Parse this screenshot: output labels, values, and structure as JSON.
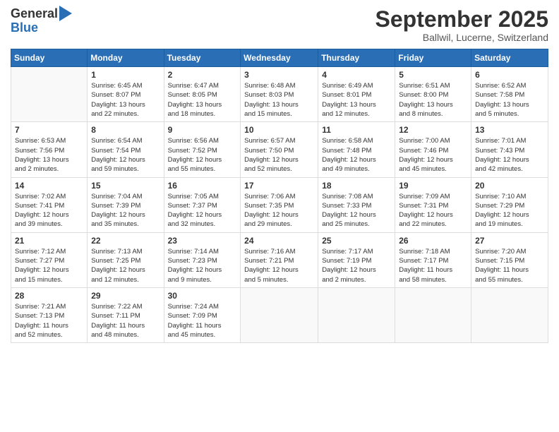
{
  "header": {
    "logo_general": "General",
    "logo_blue": "Blue",
    "month_title": "September 2025",
    "location": "Ballwil, Lucerne, Switzerland"
  },
  "days_of_week": [
    "Sunday",
    "Monday",
    "Tuesday",
    "Wednesday",
    "Thursday",
    "Friday",
    "Saturday"
  ],
  "weeks": [
    [
      {
        "day": "",
        "info": ""
      },
      {
        "day": "1",
        "info": "Sunrise: 6:45 AM\nSunset: 8:07 PM\nDaylight: 13 hours\nand 22 minutes."
      },
      {
        "day": "2",
        "info": "Sunrise: 6:47 AM\nSunset: 8:05 PM\nDaylight: 13 hours\nand 18 minutes."
      },
      {
        "day": "3",
        "info": "Sunrise: 6:48 AM\nSunset: 8:03 PM\nDaylight: 13 hours\nand 15 minutes."
      },
      {
        "day": "4",
        "info": "Sunrise: 6:49 AM\nSunset: 8:01 PM\nDaylight: 13 hours\nand 12 minutes."
      },
      {
        "day": "5",
        "info": "Sunrise: 6:51 AM\nSunset: 8:00 PM\nDaylight: 13 hours\nand 8 minutes."
      },
      {
        "day": "6",
        "info": "Sunrise: 6:52 AM\nSunset: 7:58 PM\nDaylight: 13 hours\nand 5 minutes."
      }
    ],
    [
      {
        "day": "7",
        "info": "Sunrise: 6:53 AM\nSunset: 7:56 PM\nDaylight: 13 hours\nand 2 minutes."
      },
      {
        "day": "8",
        "info": "Sunrise: 6:54 AM\nSunset: 7:54 PM\nDaylight: 12 hours\nand 59 minutes."
      },
      {
        "day": "9",
        "info": "Sunrise: 6:56 AM\nSunset: 7:52 PM\nDaylight: 12 hours\nand 55 minutes."
      },
      {
        "day": "10",
        "info": "Sunrise: 6:57 AM\nSunset: 7:50 PM\nDaylight: 12 hours\nand 52 minutes."
      },
      {
        "day": "11",
        "info": "Sunrise: 6:58 AM\nSunset: 7:48 PM\nDaylight: 12 hours\nand 49 minutes."
      },
      {
        "day": "12",
        "info": "Sunrise: 7:00 AM\nSunset: 7:46 PM\nDaylight: 12 hours\nand 45 minutes."
      },
      {
        "day": "13",
        "info": "Sunrise: 7:01 AM\nSunset: 7:43 PM\nDaylight: 12 hours\nand 42 minutes."
      }
    ],
    [
      {
        "day": "14",
        "info": "Sunrise: 7:02 AM\nSunset: 7:41 PM\nDaylight: 12 hours\nand 39 minutes."
      },
      {
        "day": "15",
        "info": "Sunrise: 7:04 AM\nSunset: 7:39 PM\nDaylight: 12 hours\nand 35 minutes."
      },
      {
        "day": "16",
        "info": "Sunrise: 7:05 AM\nSunset: 7:37 PM\nDaylight: 12 hours\nand 32 minutes."
      },
      {
        "day": "17",
        "info": "Sunrise: 7:06 AM\nSunset: 7:35 PM\nDaylight: 12 hours\nand 29 minutes."
      },
      {
        "day": "18",
        "info": "Sunrise: 7:08 AM\nSunset: 7:33 PM\nDaylight: 12 hours\nand 25 minutes."
      },
      {
        "day": "19",
        "info": "Sunrise: 7:09 AM\nSunset: 7:31 PM\nDaylight: 12 hours\nand 22 minutes."
      },
      {
        "day": "20",
        "info": "Sunrise: 7:10 AM\nSunset: 7:29 PM\nDaylight: 12 hours\nand 19 minutes."
      }
    ],
    [
      {
        "day": "21",
        "info": "Sunrise: 7:12 AM\nSunset: 7:27 PM\nDaylight: 12 hours\nand 15 minutes."
      },
      {
        "day": "22",
        "info": "Sunrise: 7:13 AM\nSunset: 7:25 PM\nDaylight: 12 hours\nand 12 minutes."
      },
      {
        "day": "23",
        "info": "Sunrise: 7:14 AM\nSunset: 7:23 PM\nDaylight: 12 hours\nand 9 minutes."
      },
      {
        "day": "24",
        "info": "Sunrise: 7:16 AM\nSunset: 7:21 PM\nDaylight: 12 hours\nand 5 minutes."
      },
      {
        "day": "25",
        "info": "Sunrise: 7:17 AM\nSunset: 7:19 PM\nDaylight: 12 hours\nand 2 minutes."
      },
      {
        "day": "26",
        "info": "Sunrise: 7:18 AM\nSunset: 7:17 PM\nDaylight: 11 hours\nand 58 minutes."
      },
      {
        "day": "27",
        "info": "Sunrise: 7:20 AM\nSunset: 7:15 PM\nDaylight: 11 hours\nand 55 minutes."
      }
    ],
    [
      {
        "day": "28",
        "info": "Sunrise: 7:21 AM\nSunset: 7:13 PM\nDaylight: 11 hours\nand 52 minutes."
      },
      {
        "day": "29",
        "info": "Sunrise: 7:22 AM\nSunset: 7:11 PM\nDaylight: 11 hours\nand 48 minutes."
      },
      {
        "day": "30",
        "info": "Sunrise: 7:24 AM\nSunset: 7:09 PM\nDaylight: 11 hours\nand 45 minutes."
      },
      {
        "day": "",
        "info": ""
      },
      {
        "day": "",
        "info": ""
      },
      {
        "day": "",
        "info": ""
      },
      {
        "day": "",
        "info": ""
      }
    ]
  ]
}
